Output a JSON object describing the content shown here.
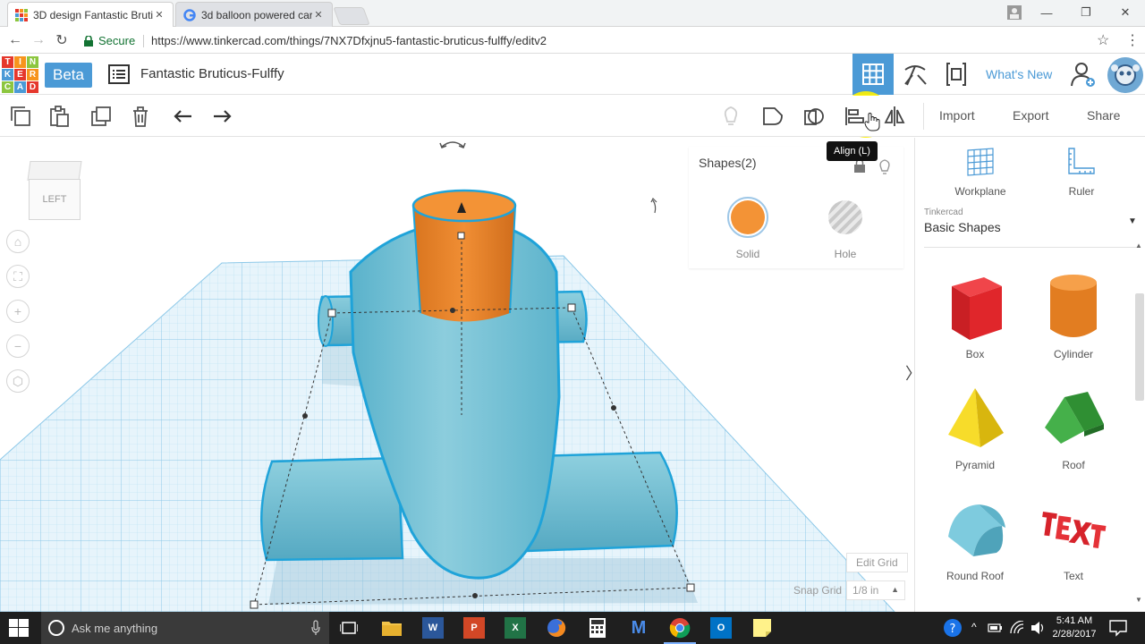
{
  "browser": {
    "tabs": [
      {
        "title": "3D design Fantastic Bruti",
        "active": true
      },
      {
        "title": "3d balloon powered car",
        "active": false
      }
    ],
    "secure_label": "Secure",
    "url": "https://www.tinkercad.com/things/7NX7Dfxjnu5-fantastic-bruticus-fulffy/editv2"
  },
  "app": {
    "logo_letters": [
      "T",
      "I",
      "N",
      "K",
      "E",
      "R",
      "C",
      "A",
      "D"
    ],
    "logo_colors": [
      "#e5372c",
      "#f7941d",
      "#8cc63f",
      "#4b9ad6",
      "#e5372c",
      "#f7941d",
      "#8cc63f",
      "#4b9ad6",
      "#e5372c"
    ],
    "beta_label": "Beta",
    "design_title": "Fantastic Bruticus-Fulffy",
    "whats_new": "What's New",
    "accent": "#4b9ad6"
  },
  "toolbar": {
    "import": "Import",
    "export": "Export",
    "share": "Share",
    "tooltip": "Align (L)"
  },
  "viewport": {
    "viewcube_face": "LEFT",
    "inspector": {
      "title": "Shapes(2)",
      "solid": "Solid",
      "hole": "Hole",
      "solid_color": "#f39336"
    },
    "edit_grid": "Edit Grid",
    "snap_grid_label": "Snap Grid",
    "snap_grid_value": "1/8 in"
  },
  "panel": {
    "workplane": "Workplane",
    "ruler": "Ruler",
    "library_source": "Tinkercad",
    "library_name": "Basic Shapes",
    "shapes": [
      "Box",
      "Cylinder",
      "Pyramid",
      "Roof",
      "Round Roof",
      "Text"
    ]
  },
  "taskbar": {
    "search_placeholder": "Ask me anything",
    "time": "5:41 AM",
    "date": "2/28/2017"
  }
}
